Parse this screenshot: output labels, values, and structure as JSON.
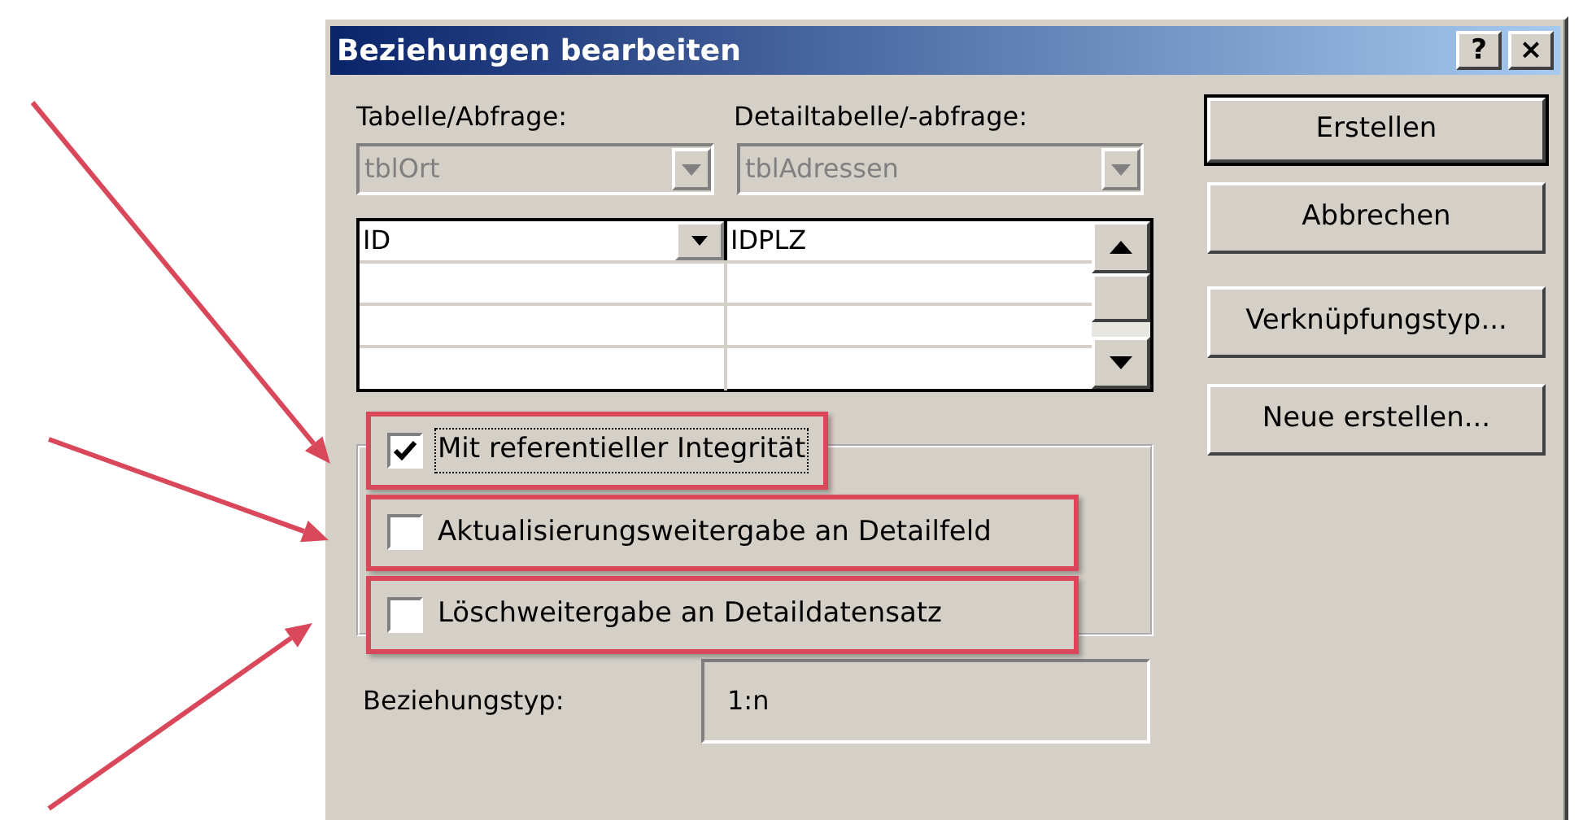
{
  "window": {
    "title": "Beziehungen bearbeiten",
    "help_button": "?",
    "close_button": "×"
  },
  "table_label": "Tabelle/Abfrage:",
  "detail_label": "Detailtabelle/-abfrage:",
  "table_combo": {
    "value": "tblOrt",
    "disabled": true
  },
  "detail_combo": {
    "value": "tblAdressen",
    "disabled": true
  },
  "field_grid": {
    "rows": [
      {
        "column_1": "ID",
        "column_2": "IDPLZ",
        "active": true
      }
    ]
  },
  "options": [
    {
      "label": "Mit referentieller Integrität",
      "checked": true,
      "focused": true,
      "highlighted": true
    },
    {
      "label": "Aktualisierungsweitergabe an Detailfeld",
      "checked": false,
      "focused": false,
      "highlighted": true
    },
    {
      "label": "Löschweitergabe an Detaildatensatz",
      "checked": false,
      "focused": false,
      "highlighted": true
    }
  ],
  "relationship_type": {
    "label": "Beziehungstyp:",
    "value": "1:n"
  },
  "buttons": [
    {
      "label": "Erstellen",
      "default": true
    },
    {
      "label": "Abbrechen",
      "default": false
    },
    {
      "label": "Verknüpfungstyp...",
      "default": false
    },
    {
      "label": "Neue erstellen...",
      "default": false
    }
  ]
}
